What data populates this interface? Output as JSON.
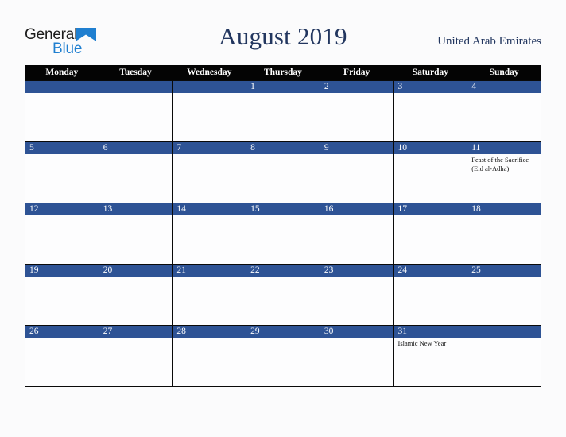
{
  "brand": {
    "word1": "General",
    "word2": "Blue",
    "triangle_color": "#1f7fd0",
    "word1_color": "#1b1b1b",
    "word2_color": "#1f7fd0"
  },
  "header": {
    "title": "August 2019",
    "country": "United Arab Emirates",
    "title_color": "#22365f"
  },
  "calendar": {
    "header_bg": "#040404",
    "daynum_bg": "#2e5395",
    "weekdays": [
      "Monday",
      "Tuesday",
      "Wednesday",
      "Thursday",
      "Friday",
      "Saturday",
      "Sunday"
    ],
    "weeks": [
      [
        {
          "day": "",
          "events": []
        },
        {
          "day": "",
          "events": []
        },
        {
          "day": "",
          "events": []
        },
        {
          "day": "1",
          "events": []
        },
        {
          "day": "2",
          "events": []
        },
        {
          "day": "3",
          "events": []
        },
        {
          "day": "4",
          "events": []
        }
      ],
      [
        {
          "day": "5",
          "events": []
        },
        {
          "day": "6",
          "events": []
        },
        {
          "day": "7",
          "events": []
        },
        {
          "day": "8",
          "events": []
        },
        {
          "day": "9",
          "events": []
        },
        {
          "day": "10",
          "events": []
        },
        {
          "day": "11",
          "events": [
            "Feast of the Sacrifice (Eid al-Adha)"
          ]
        }
      ],
      [
        {
          "day": "12",
          "events": []
        },
        {
          "day": "13",
          "events": []
        },
        {
          "day": "14",
          "events": []
        },
        {
          "day": "15",
          "events": []
        },
        {
          "day": "16",
          "events": []
        },
        {
          "day": "17",
          "events": []
        },
        {
          "day": "18",
          "events": []
        }
      ],
      [
        {
          "day": "19",
          "events": []
        },
        {
          "day": "20",
          "events": []
        },
        {
          "day": "21",
          "events": []
        },
        {
          "day": "22",
          "events": []
        },
        {
          "day": "23",
          "events": []
        },
        {
          "day": "24",
          "events": []
        },
        {
          "day": "25",
          "events": []
        }
      ],
      [
        {
          "day": "26",
          "events": []
        },
        {
          "day": "27",
          "events": []
        },
        {
          "day": "28",
          "events": []
        },
        {
          "day": "29",
          "events": []
        },
        {
          "day": "30",
          "events": []
        },
        {
          "day": "31",
          "events": [
            "Islamic New Year"
          ]
        },
        {
          "day": "",
          "events": []
        }
      ]
    ]
  }
}
